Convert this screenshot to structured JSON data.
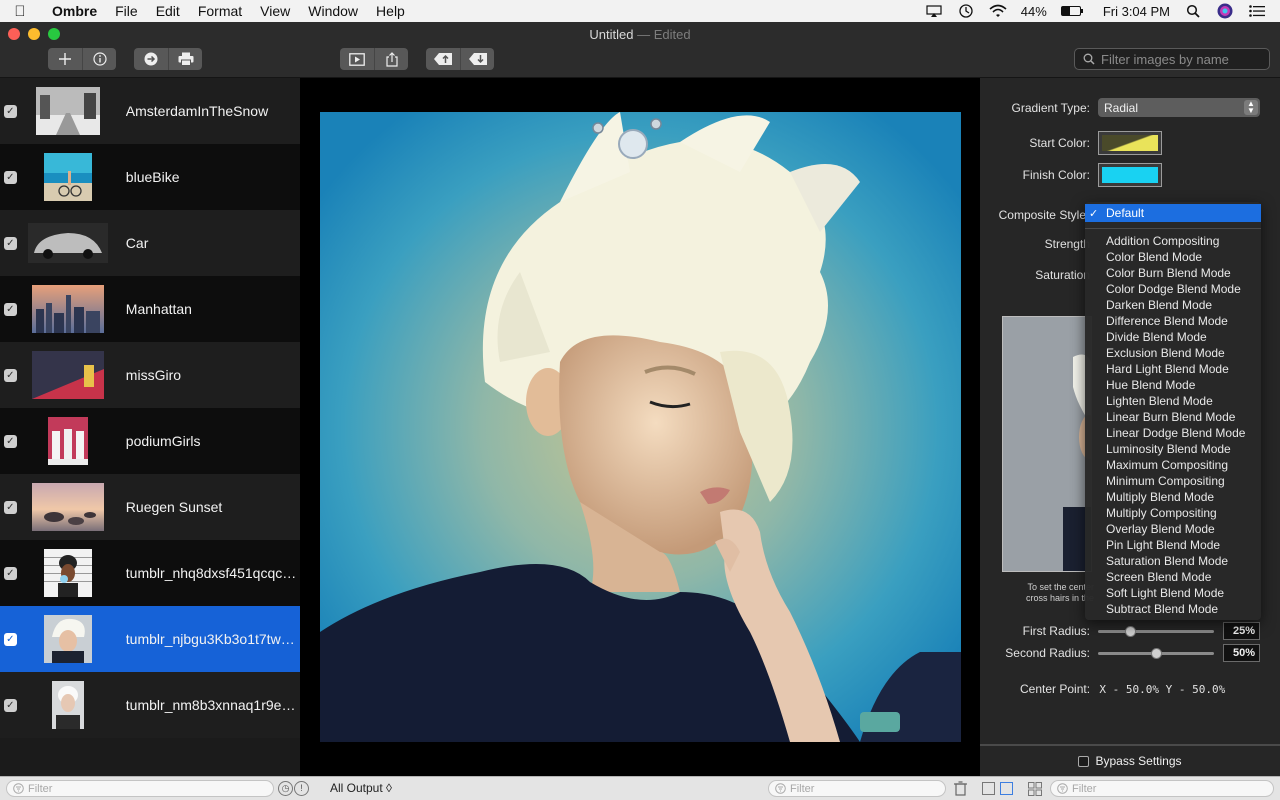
{
  "menubar": {
    "apple": "",
    "app_name": "Ombre",
    "items": [
      "File",
      "Edit",
      "Format",
      "View",
      "Window",
      "Help"
    ],
    "battery": "44%",
    "battery_level": 0.44,
    "clock": "Fri 3:04 PM"
  },
  "window": {
    "title": "Untitled",
    "edited": "— Edited"
  },
  "toolbar": {
    "search_placeholder": "Filter images by name"
  },
  "images": [
    {
      "name": "AmsterdamInTheSnow",
      "checked": true
    },
    {
      "name": "blueBike",
      "checked": true
    },
    {
      "name": "Car",
      "checked": true
    },
    {
      "name": "Manhattan",
      "checked": true
    },
    {
      "name": "missGiro",
      "checked": true
    },
    {
      "name": "podiumGirls",
      "checked": true
    },
    {
      "name": "Ruegen Sunset",
      "checked": true
    },
    {
      "name": "tumblr_nhq8dxsf451qcqckt…",
      "checked": true
    },
    {
      "name": "tumblr_njbgu3Kb3o1t7tw8…",
      "checked": true,
      "selected": true
    },
    {
      "name": "tumblr_nm8b3xnnaq1r9ecc…",
      "checked": true
    }
  ],
  "inspector": {
    "gradient_type_label": "Gradient Type:",
    "gradient_type_value": "Radial",
    "start_color_label": "Start Color:",
    "finish_color_label": "Finish Color:",
    "composite_style_label": "Composite Style",
    "strength_label": "Strength",
    "saturation_label": "Saturation",
    "hint_line1": "To set the center",
    "hint_line2": "cross hairs in the",
    "first_radius_label": "First Radius:",
    "first_radius_value": "25%",
    "second_radius_label": "Second Radius:",
    "second_radius_value": "50%",
    "center_point_label": "Center Point:",
    "center_point_value": "X - 50.0%  Y - 50.0%",
    "bypass_label": "Bypass Settings",
    "colors": {
      "start": "#e9e35a",
      "finish": "#19d2f2"
    }
  },
  "composite_menu": {
    "selected": "Default",
    "items": [
      "Addition Compositing",
      "Color Blend Mode",
      "Color Burn Blend Mode",
      "Color Dodge Blend Mode",
      "Darken Blend Mode",
      "Difference Blend Mode",
      "Divide Blend Mode",
      "Exclusion Blend Mode",
      "Hard Light Blend Mode",
      "Hue Blend Mode",
      "Lighten Blend Mode",
      "Linear Burn Blend Mode",
      "Linear Dodge Blend Mode",
      "Luminosity Blend Mode",
      "Maximum Compositing",
      "Minimum Compositing",
      "Multiply Blend Mode",
      "Multiply Compositing",
      "Overlay Blend Mode",
      "Pin Light Blend Mode",
      "Saturation Blend Mode",
      "Screen Blend Mode",
      "Soft Light Blend Mode",
      "Subtract Blend Mode"
    ]
  },
  "statusbar": {
    "filter_left": "Filter",
    "output_select": "All Output ◊",
    "filter_mid": "Filter",
    "filter_right": "Filter"
  }
}
